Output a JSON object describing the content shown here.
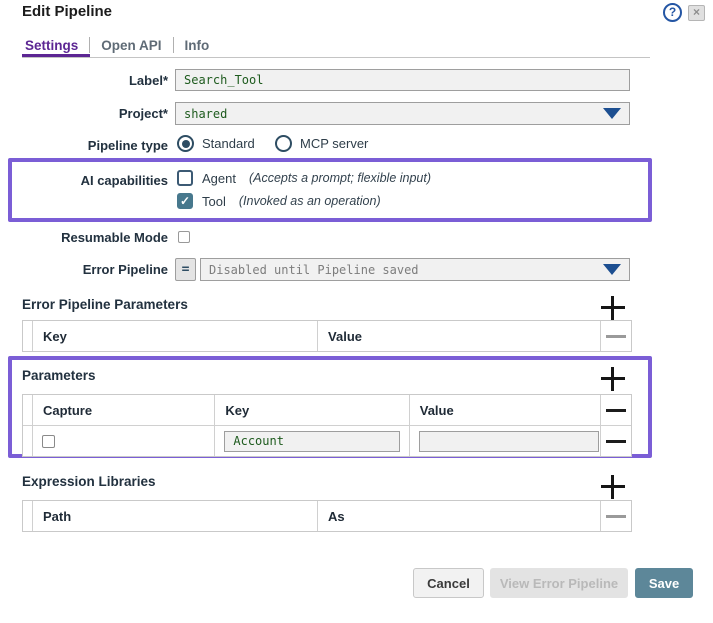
{
  "colors": {
    "accent_purple_highlight": "#7b5ed6",
    "tab_active_purple": "#5c2693",
    "save_button_teal": "#5d8799",
    "checked_checkbox_teal": "#47788d",
    "input_value_green": "#1e5b1e",
    "dropdown_arrow_blue": "#1d4f91",
    "help_icon_blue": "#2456a4"
  },
  "dialog": {
    "title": "Edit Pipeline",
    "titlebar": {
      "help": "?",
      "close": "×"
    },
    "tabs": [
      {
        "label": "Settings",
        "active": true
      },
      {
        "label": "Open API",
        "active": false
      },
      {
        "label": "Info",
        "active": false
      }
    ],
    "form": {
      "label_field": {
        "label": "Label*",
        "value": "Search_Tool"
      },
      "project_field": {
        "label": "Project*",
        "value": "shared"
      },
      "pipeline_type": {
        "label": "Pipeline type",
        "standard": "Standard",
        "mcp": "MCP server",
        "selected": "Standard"
      },
      "ai_capabilities": {
        "label": "AI capabilities",
        "agent": {
          "label": "Agent",
          "note": "(Accepts a prompt; flexible input)",
          "checked": false
        },
        "tool": {
          "label": "Tool",
          "note": "(Invoked as an operation)",
          "checked": true
        }
      },
      "resumable": {
        "label": "Resumable Mode",
        "checked": false
      },
      "error_pipeline": {
        "label": "Error Pipeline",
        "operator": "=",
        "value": "Disabled until Pipeline saved"
      }
    },
    "error_pipeline_parameters": {
      "title": "Error Pipeline Parameters",
      "headers": {
        "key": "Key",
        "value": "Value"
      }
    },
    "parameters": {
      "title": "Parameters",
      "headers": {
        "capture": "Capture",
        "key": "Key",
        "value": "Value"
      },
      "row": {
        "capture_checked": false,
        "key": "Account",
        "value": ""
      }
    },
    "expression_libraries": {
      "title": "Expression Libraries",
      "headers": {
        "path": "Path",
        "as": "As"
      }
    },
    "footer": {
      "cancel": "Cancel",
      "view_error": "View Error Pipeline",
      "save": "Save"
    }
  }
}
